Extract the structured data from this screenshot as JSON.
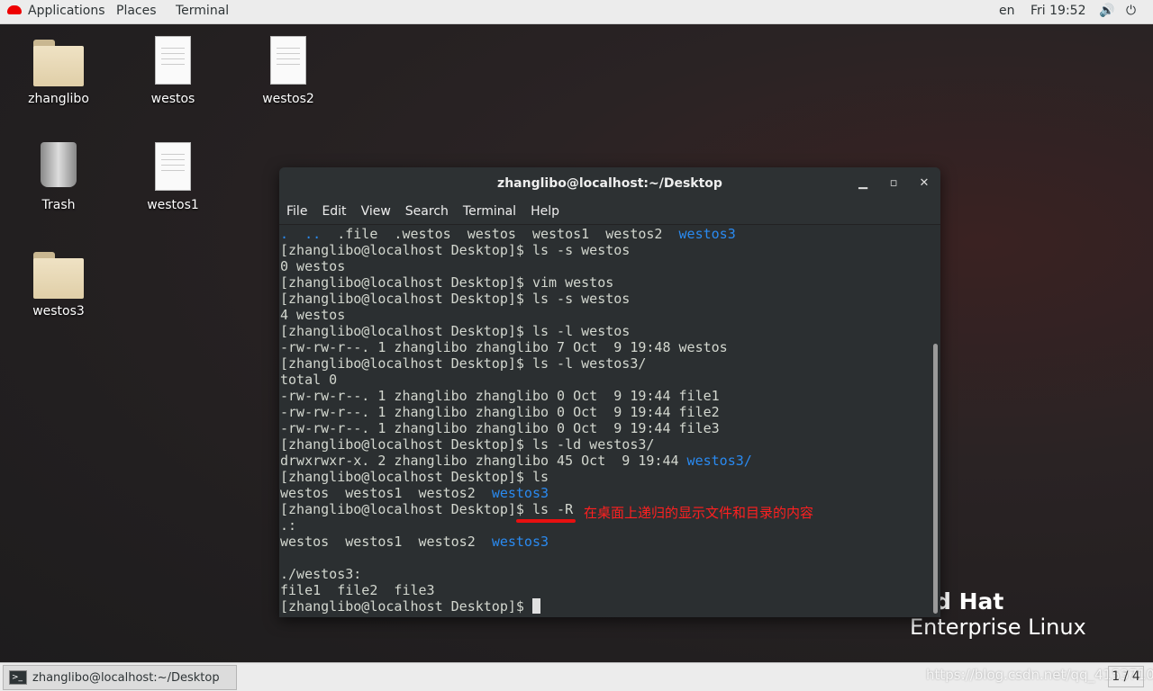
{
  "topbar": {
    "applications": "Applications",
    "places": "Places",
    "terminal": "Terminal",
    "lang": "en",
    "clock": "Fri 19:52"
  },
  "desktop": {
    "icons": [
      "zhanglibo",
      "westos",
      "westos2",
      "Trash",
      "westos1",
      "westos3"
    ]
  },
  "terminal": {
    "title": "zhanglibo@localhost:~/Desktop",
    "menu": [
      "File",
      "Edit",
      "View",
      "Search",
      "Terminal",
      "Help"
    ],
    "lines": [
      [
        [
          ".  ..",
          "blue"
        ],
        [
          "  .file  .westos  westos  westos1  westos2  ",
          ""
        ],
        [
          "westos3",
          "blue"
        ]
      ],
      [
        [
          "[zhanglibo@localhost Desktop]$ ls -s westos",
          ""
        ]
      ],
      [
        [
          "0 westos",
          ""
        ]
      ],
      [
        [
          "[zhanglibo@localhost Desktop]$ vim westos",
          ""
        ]
      ],
      [
        [
          "[zhanglibo@localhost Desktop]$ ls -s westos",
          ""
        ]
      ],
      [
        [
          "4 westos",
          ""
        ]
      ],
      [
        [
          "[zhanglibo@localhost Desktop]$ ls -l westos",
          ""
        ]
      ],
      [
        [
          "-rw-rw-r--. 1 zhanglibo zhanglibo 7 Oct  9 19:48 westos",
          ""
        ]
      ],
      [
        [
          "[zhanglibo@localhost Desktop]$ ls -l westos3/",
          ""
        ]
      ],
      [
        [
          "total 0",
          ""
        ]
      ],
      [
        [
          "-rw-rw-r--. 1 zhanglibo zhanglibo 0 Oct  9 19:44 file1",
          ""
        ]
      ],
      [
        [
          "-rw-rw-r--. 1 zhanglibo zhanglibo 0 Oct  9 19:44 file2",
          ""
        ]
      ],
      [
        [
          "-rw-rw-r--. 1 zhanglibo zhanglibo 0 Oct  9 19:44 file3",
          ""
        ]
      ],
      [
        [
          "[zhanglibo@localhost Desktop]$ ls -ld westos3/",
          ""
        ]
      ],
      [
        [
          "drwxrwxr-x. 2 zhanglibo zhanglibo 45 Oct  9 19:44 ",
          ""
        ],
        [
          "westos3/",
          "blue"
        ]
      ],
      [
        [
          "[zhanglibo@localhost Desktop]$ ls",
          ""
        ]
      ],
      [
        [
          "westos  westos1  westos2  ",
          ""
        ],
        [
          "westos3",
          "blue"
        ]
      ],
      [
        [
          "[zhanglibo@localhost Desktop]$ ls -R",
          ""
        ]
      ],
      [
        [
          ".:",
          ""
        ]
      ],
      [
        [
          "westos  westos1  westos2  ",
          ""
        ],
        [
          "westos3",
          "blue"
        ]
      ],
      [
        [
          "",
          ""
        ]
      ],
      [
        [
          "./westos3:",
          ""
        ]
      ],
      [
        [
          "file1  file2  file3",
          ""
        ]
      ],
      [
        [
          "[zhanglibo@localhost Desktop]$ ",
          ""
        ]
      ]
    ],
    "annotation": "在桌面上递归的显示文件和目录的内容"
  },
  "branding": {
    "line1": "d Hat",
    "line2": "Enterprise Linux"
  },
  "taskbar": {
    "task": "zhanglibo@localhost:~/Desktop",
    "workspace": "1 / 4",
    "watermark": "https://blog.csdn.net/qq_41537102"
  }
}
